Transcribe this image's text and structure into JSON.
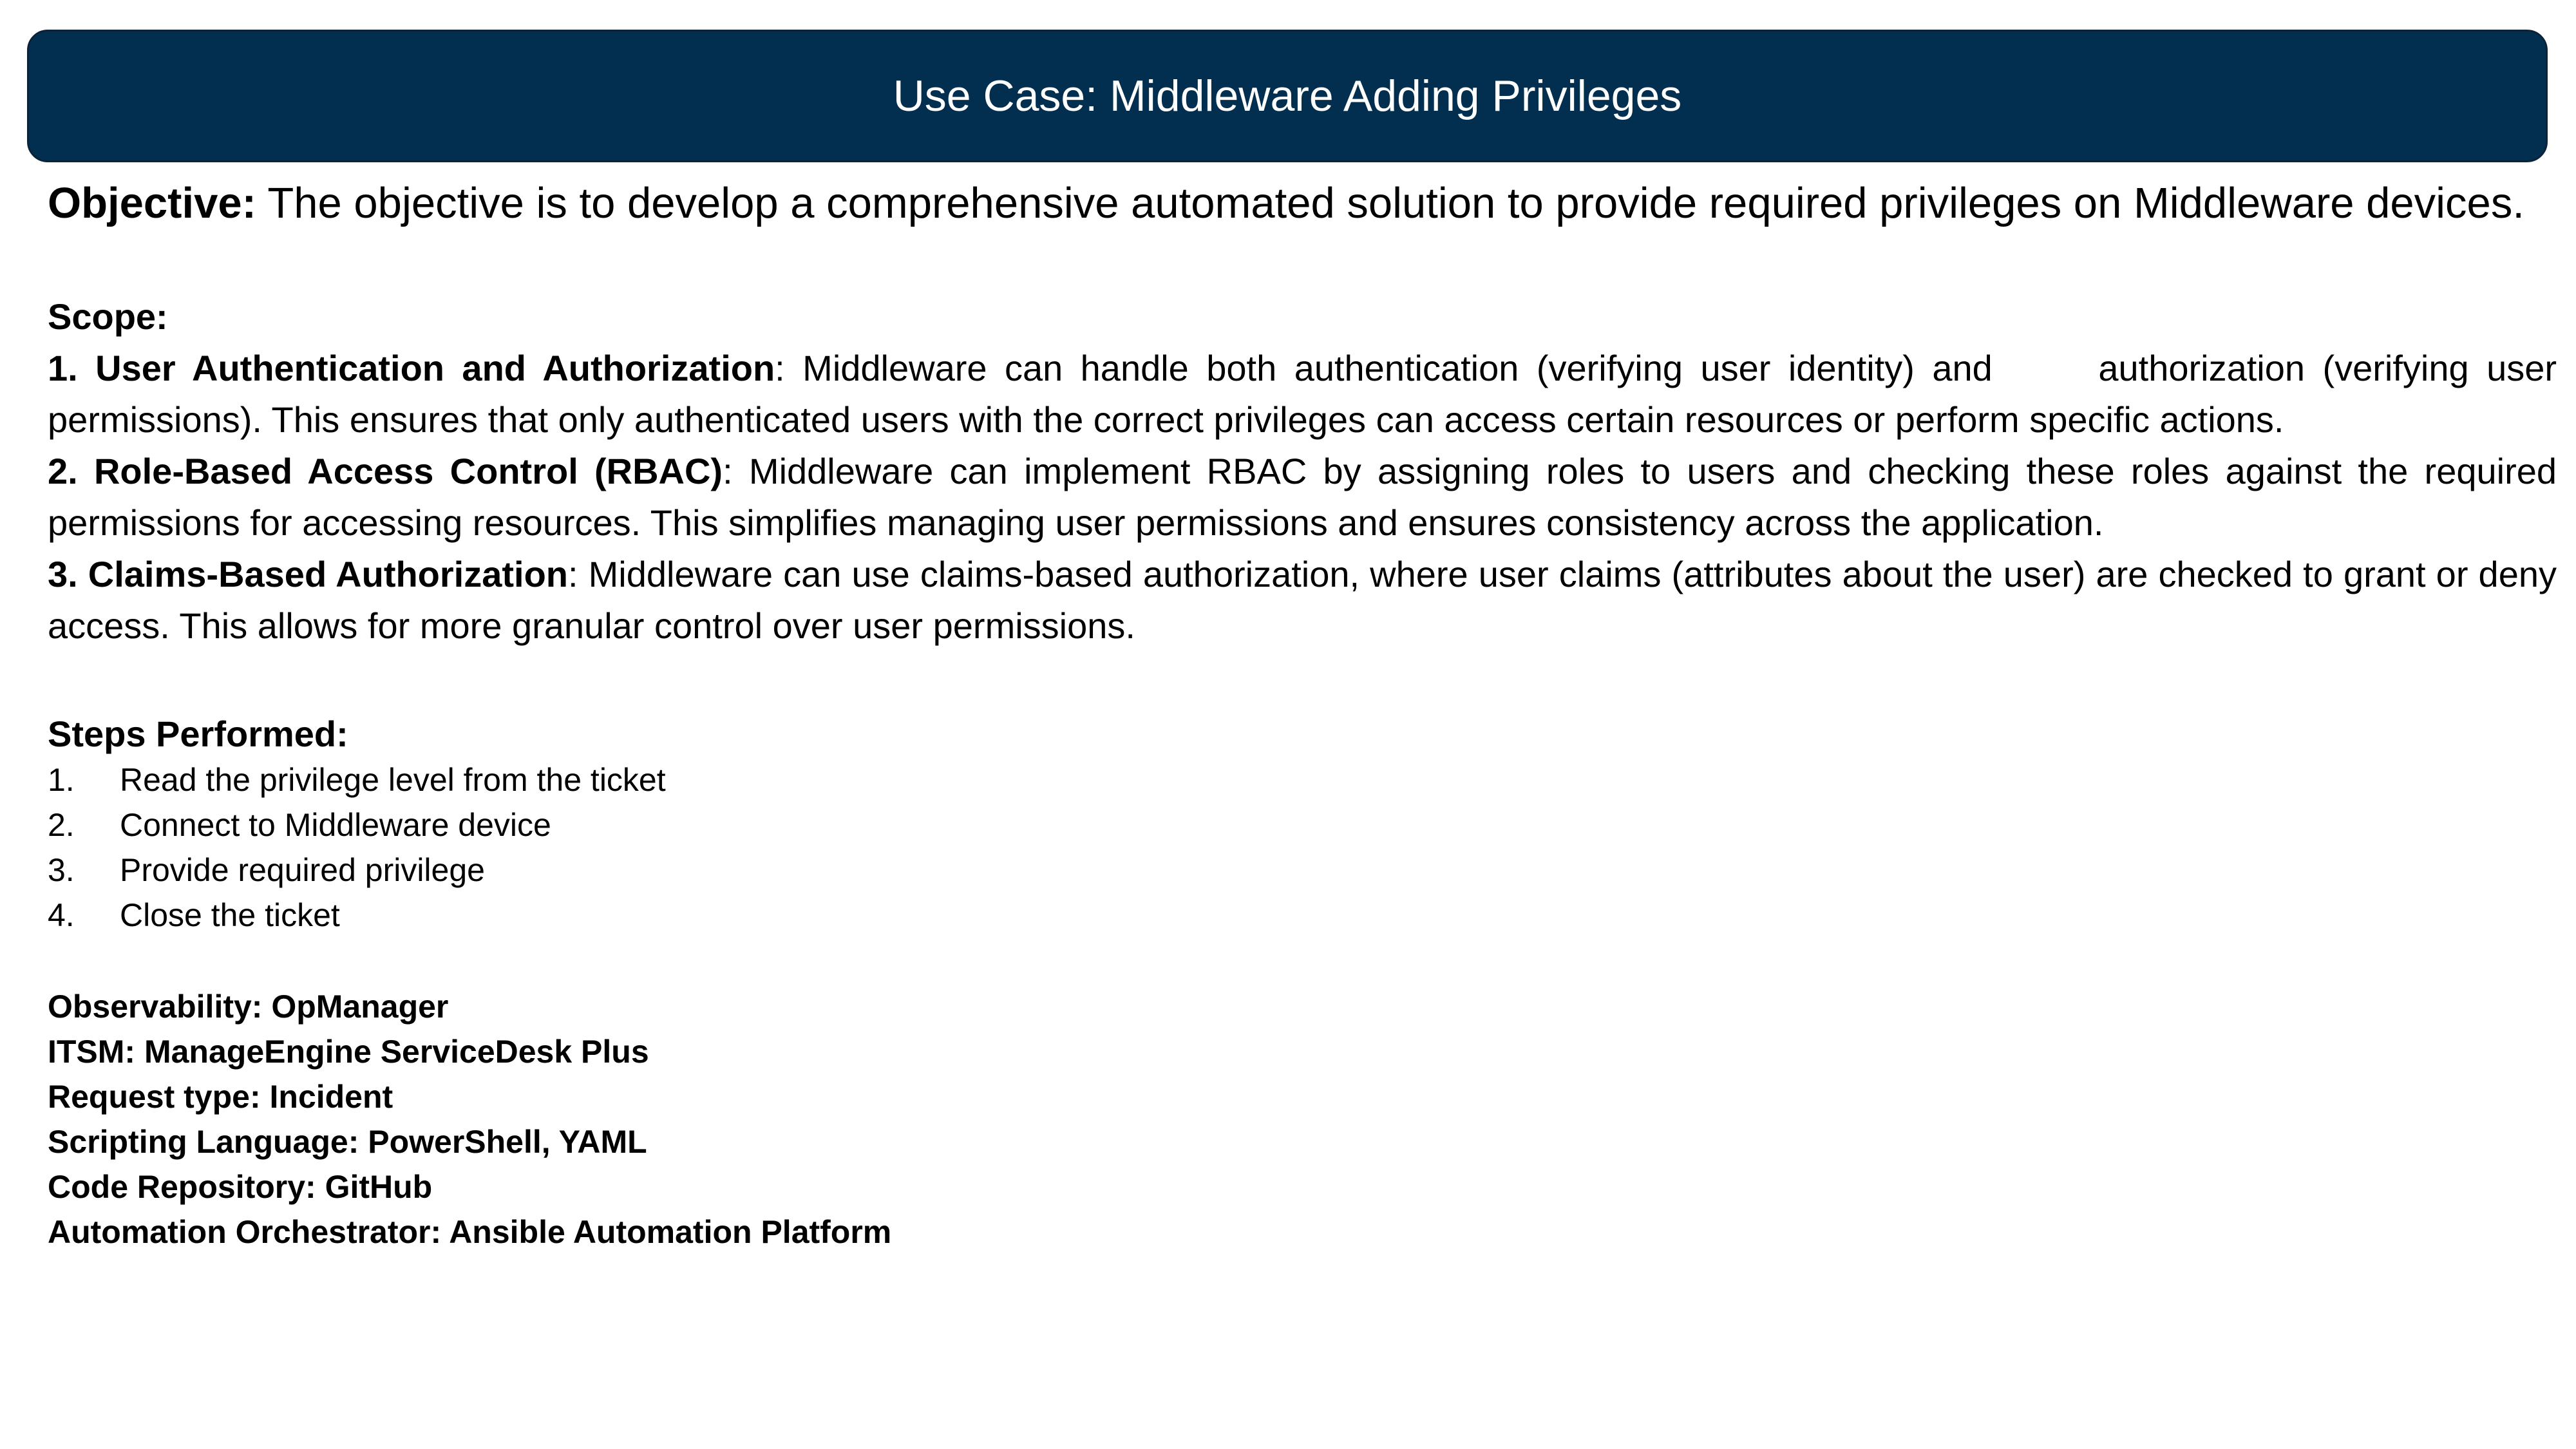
{
  "title": "Use Case: Middleware Adding Privileges",
  "objective": {
    "label": "Objective:",
    "text": " The objective is to develop a comprehensive automated solution to provide required privileges on Middleware devices."
  },
  "scope": {
    "heading": "Scope:",
    "items": [
      {
        "title": "1.  User Authentication and Authorization",
        "text": ": Middleware can handle both authentication (verifying user identity) and      authorization (verifying user permissions). This ensures that only authenticated users with the correct privileges can access certain resources or perform specific actions."
      },
      {
        "title": "2. Role-Based Access Control (RBAC)",
        "text": ": Middleware can implement RBAC by assigning roles to users and checking these roles against the required permissions for accessing resources. This simplifies managing user permissions and ensures consistency across the application."
      },
      {
        "title": "3. Claims-Based Authorization",
        "text": ": Middleware can use claims-based authorization, where user claims (attributes about the user) are checked to grant or deny access. This allows for more granular control over user permissions."
      }
    ]
  },
  "steps": {
    "heading": "Steps Performed:",
    "items": [
      {
        "num": "1.",
        "text": "Read the privilege level from the ticket"
      },
      {
        "num": "2.",
        "text": "Connect to Middleware device"
      },
      {
        "num": "3.",
        "text": "Provide required privilege"
      },
      {
        "num": "4.",
        "text": "Close the ticket"
      }
    ]
  },
  "tools": [
    "Observability: OpManager",
    "ITSM: ManageEngine ServiceDesk Plus",
    "Request type: Incident",
    "Scripting Language: PowerShell, YAML",
    "Code Repository: GitHub",
    "Automation Orchestrator: Ansible Automation Platform"
  ],
  "colors": {
    "banner_background": "#022f4f",
    "banner_text": "#ffffff",
    "body_text": "#000000"
  }
}
